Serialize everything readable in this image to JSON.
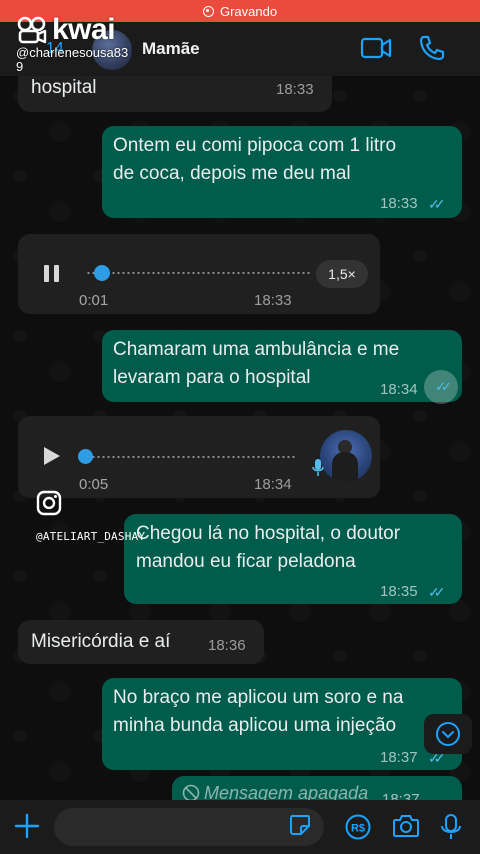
{
  "recording": {
    "label": "Gravando"
  },
  "overlay": {
    "brand": "kwai",
    "username": "@charlenesousa839",
    "instagram_handle": "@ATELIART_DASHAY"
  },
  "header": {
    "back_count": "14",
    "contact_name": "Mamãe"
  },
  "messages": [
    {
      "text": "hospital",
      "time": "18:33"
    },
    {
      "text_line1": "Ontem eu comi pipoca com 1 litro",
      "text_line2": "de coca, depois me deu mal",
      "time": "18:33"
    },
    {
      "duration": "0:01",
      "time": "18:33",
      "speed": "1,5×",
      "progress": 0.05
    },
    {
      "text_line1": "Chamaram uma ambulância e me",
      "text_line2": "levaram para o hospital",
      "time": "18:34"
    },
    {
      "duration": "0:05",
      "time": "18:34",
      "progress": 0.0
    },
    {
      "text_line1": "Chegou lá no hospital, o doutor",
      "text_line2": "mandou eu ficar peladona",
      "time": "18:35"
    },
    {
      "text": "Misericórdia e aí",
      "time": "18:36"
    },
    {
      "text_line1": "No braço me aplicou um soro e na",
      "text_line2": "minha bunda aplicou uma injeção",
      "time": "18:37"
    },
    {
      "text": "Mensagem apagada",
      "time": "18:37"
    }
  ],
  "colors": {
    "outgoing": "#005d4b",
    "incoming": "#202020",
    "accent": "#1aa3ff",
    "read_ticks": "#53bdeb",
    "recording": "#ea4b3c"
  },
  "icons": {
    "video": "video-camera-icon",
    "call": "phone-icon",
    "attach": "plus-icon",
    "sticker": "sticker-icon",
    "payment": "pix-icon",
    "camera": "camera-icon",
    "mic": "microphone-icon"
  }
}
